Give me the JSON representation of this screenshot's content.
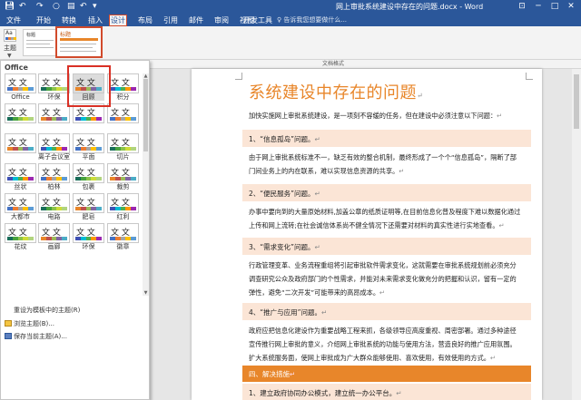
{
  "title_bar": {
    "document_title": "网上审批系统建设中存在的问题.docx - Word",
    "controls": [
      "⊡",
      "─",
      "□",
      "✕"
    ]
  },
  "menu": {
    "tabs": [
      "文件",
      "开始",
      "转换",
      "插入",
      "设计",
      "布局",
      "引用",
      "邮件",
      "审阅",
      "视图",
      "开发工具"
    ],
    "active_tab": "设计",
    "tell_me": "告诉我您想要做什么..."
  },
  "ribbon": {
    "theme_button": "主题",
    "style_thumbs": [
      {
        "title": "标题"
      },
      {
        "title": "标题"
      }
    ],
    "group_label": "文档格式"
  },
  "theme_panel": {
    "header": "Office",
    "themes": [
      "Office",
      "环保",
      "回顾",
      "积分",
      "",
      "",
      "",
      "",
      "",
      "离子会议室",
      "平面",
      "切片",
      "丝状",
      "柏林",
      "包裹",
      "裁剪",
      "大都市",
      "电路",
      "肥皂",
      "红利",
      "花纹",
      "画廊",
      "环保",
      "徽章"
    ],
    "selected": "回顾",
    "links": [
      "重设为模板中的主题(R)",
      "浏览主题(B)...",
      "保存当前主题(A)..."
    ]
  },
  "document": {
    "heading": "系统建设中存在的问题",
    "intro": "加快实施网上审批系统建设，是一项刻不容缓的任务，但在建设中必须注意以下问题：",
    "sections": [
      {
        "band": "1、“信息孤岛”问题。",
        "body": "由于网上审批系统标准不一，缺乏有效的整合机制，最终形成了一个个“信息孤岛”，隔断了部门间业务上的内在联系，难以实现信息资源的共享。"
      },
      {
        "band": "2、“便民服务”问题。",
        "body": "办事中要向到的大量原始材料,加盖公章的纸质证明等,在目前信息化普及程度下难以数据化通过上传和网上流转;在社会诚信体系尚不健全情况下还需要对材料的真实性进行实地查看。"
      },
      {
        "band": "3、“需求变化”问题。",
        "body": "行政管理变革、业务流程重组将引起审批软件需求变化，这就需要在审批系统规划前必须充分调查研究公众及政府部门的个性需求，并能对未来需求变化做充分的把握和认识，留有一定的弹性，避免“二次开发”可能带来的高昂成本。"
      },
      {
        "band": "4、“推广与应用”问题。",
        "body": "政府应把信息化建设作为重要战略工程来抓，各级领导应高度重视、周密部署。通过多种途径宣传推行网上审批的意义，介绍网上审批系统的功能与使用方法，营造良好的推广应用氛围。扩大系统服务面，使网上审批成为广大群众能够使用、喜欢使用，有效使用的方式。"
      }
    ],
    "solution_band": "四、解决措施",
    "last_band": "1、建立政府协同办公模式，建立统一办公平台。"
  },
  "colors": {
    "word_blue": "#2b579a",
    "accent_orange": "#e8862a",
    "band_peach": "#fbe5d6",
    "highlight_red": "#d93025"
  }
}
